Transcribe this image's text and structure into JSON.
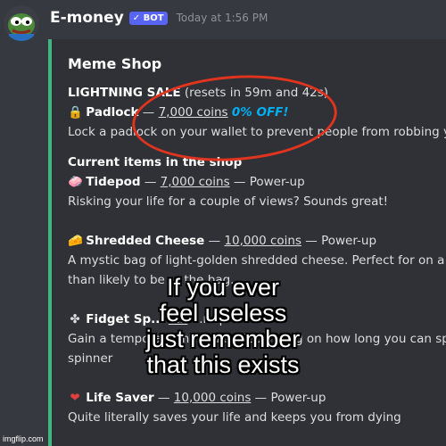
{
  "message": {
    "username": "E-money",
    "bot_tag": "✓ BOT",
    "timestamp": "Today at 1:56 PM"
  },
  "embed": {
    "title": "Meme Shop",
    "sale": {
      "label": "LIGHTNING SALE",
      "resets": "(resets in 59m and 42s)",
      "item_name": "Padlock",
      "sep": "—",
      "price": "7,000 coins",
      "discount": "0% OFF!",
      "description": "Lock a padlock on your wallet to prevent people from robbing you"
    },
    "current_heading": "Current items in the shop",
    "items": [
      {
        "name": "Tidepod",
        "sep": "—",
        "price": "7,000 coins",
        "sep2": "—",
        "category": "Power-up",
        "description": [
          "Risking your life for a couple of views? Sounds great!"
        ]
      },
      {
        "name": "Shredded Cheese",
        "sep": "—",
        "price": "10,000 coins",
        "sep2": "—",
        "category": "Power-up",
        "description": [
          "A mystic bag of light-golden shredded cheese. Perfect for on a pizza",
          "than likely to be ... the bag."
        ]
      },
      {
        "name": "Fidget Sp...",
        "sep": "",
        "price": "...3",
        "sep2": "",
        "category": "...r-up",
        "description": [
          "Gain a temporary multiplier depending on how long you can spin yo",
          "spinner"
        ]
      },
      {
        "name": "Life Saver",
        "sep": "—",
        "price": "10,000 coins",
        "sep2": "—",
        "category": "Power-up",
        "description": [
          "Quite literally saves your life and keeps you from dying"
        ]
      }
    ]
  },
  "overlay": {
    "lines": [
      "If you ever",
      "feel useless",
      "just remember",
      "that this exists"
    ]
  },
  "watermark": "imgflip.com",
  "colors": {
    "background": "#36393f",
    "embed": "#2f3136",
    "accent": "#43b581",
    "circle": "#e0341f",
    "discount": "#00b0f4"
  }
}
